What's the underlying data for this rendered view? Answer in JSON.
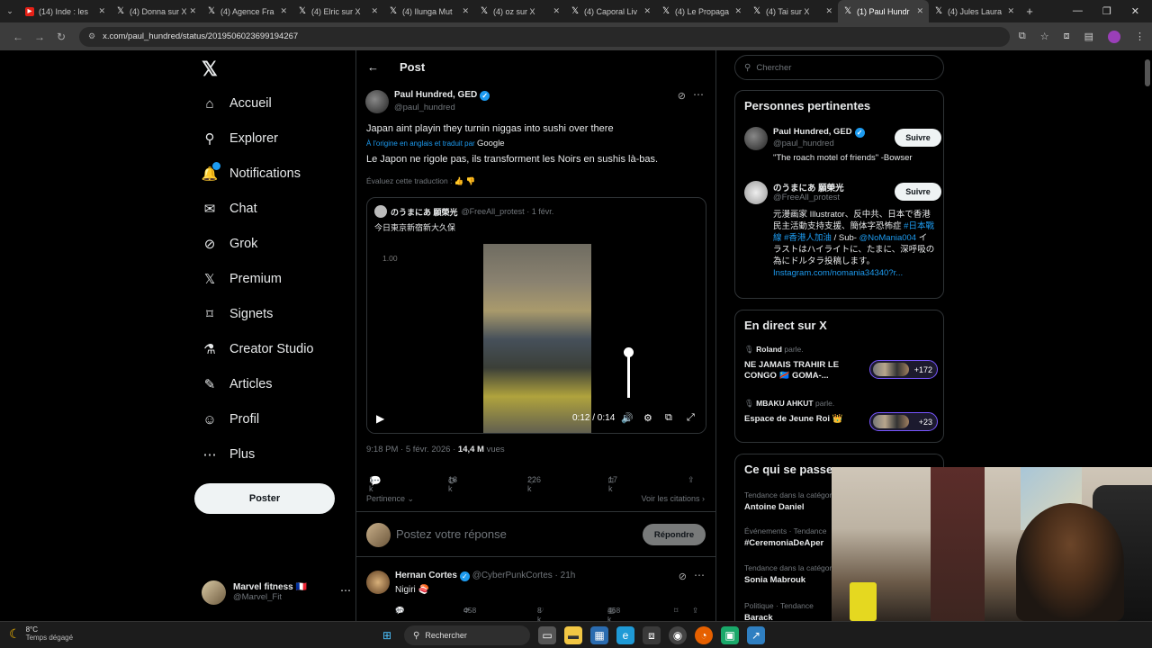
{
  "browser": {
    "tabs": [
      {
        "label": "(14) Inde : les",
        "icon": "youtube-icon",
        "active": false
      },
      {
        "label": "(4) Donna sur X",
        "icon": "x-icon",
        "active": false
      },
      {
        "label": "(4) Agence Fra",
        "icon": "x-icon",
        "active": false
      },
      {
        "label": "(4) Elric sur X",
        "icon": "x-icon",
        "active": false
      },
      {
        "label": "(4) Ilunga Mut",
        "icon": "x-icon",
        "active": false
      },
      {
        "label": "(4) oz sur X",
        "icon": "x-icon",
        "active": false
      },
      {
        "label": "(4) Caporal Liv",
        "icon": "x-icon",
        "active": false
      },
      {
        "label": "(4) Le Propaga",
        "icon": "x-icon",
        "active": false
      },
      {
        "label": "(4) Tai sur X",
        "icon": "x-icon",
        "active": false
      },
      {
        "label": "(1) Paul Hundr",
        "icon": "x-icon",
        "active": true
      },
      {
        "label": "(4) Jules Laura",
        "icon": "x-icon",
        "active": false
      }
    ],
    "url": "x.com/paul_hundred/status/2019506023699194267"
  },
  "nav": {
    "items": [
      {
        "label": "Accueil",
        "icon": "home-icon",
        "glyph": "⌂"
      },
      {
        "label": "Explorer",
        "icon": "search-icon",
        "glyph": "⚲"
      },
      {
        "label": "Notifications",
        "icon": "bell-icon",
        "glyph": "🔔"
      },
      {
        "label": "Chat",
        "icon": "mail-icon",
        "glyph": "✉"
      },
      {
        "label": "Grok",
        "icon": "grok-icon",
        "glyph": "⊘"
      },
      {
        "label": "Premium",
        "icon": "x-premium-icon",
        "glyph": "𝕏"
      },
      {
        "label": "Signets",
        "icon": "bookmark-icon",
        "glyph": "⌑"
      },
      {
        "label": "Creator Studio",
        "icon": "flask-icon",
        "glyph": "⚗"
      },
      {
        "label": "Articles",
        "icon": "article-icon",
        "glyph": "✎"
      },
      {
        "label": "Profil",
        "icon": "person-icon",
        "glyph": "☺"
      },
      {
        "label": "Plus",
        "icon": "more-circle-icon",
        "glyph": "⋯"
      }
    ],
    "post_label": "Poster",
    "me": {
      "name": "Marvel fitness 🇫🇷",
      "handle": "@Marvel_Fit"
    }
  },
  "main": {
    "header_title": "Post",
    "author": {
      "name": "Paul Hundred, GED",
      "handle": "@paul_hundred"
    },
    "text": "Japan aint playin they turnin niggas into sushi over there",
    "translated_prefix": "À l'origine en anglais et traduit par",
    "translated_by": "Google",
    "text_fr": "Le Japon ne rigole pas, ils transforment les Noirs en sushis là-bas.",
    "rate_translation": "Évaluez cette traduction :",
    "quote": {
      "name": "のうまにあ 願榮光",
      "handle": "@FreeAll_protest",
      "date": "· 1 févr.",
      "text": "今日東京新宿新大久保",
      "video": {
        "rate": "1.00",
        "time": "0:12 / 0:14",
        "volume_level": 0.85
      }
    },
    "timestamp": "9:18 PM · 5 févr. 2026 ·",
    "views_count": "14,4 M",
    "views_label": "vues",
    "stats": {
      "replies": "1 k",
      "reposts": "18 k",
      "likes": "226 k",
      "bookmarks": "17 k"
    },
    "sort_label": "Pertinence",
    "quotes_label": "Voir les citations",
    "reply_placeholder": "Postez votre réponse",
    "reply_button": "Répondre",
    "reply": {
      "name": "Hernan Cortes",
      "handle": "@CyberPunkCortes",
      "time": "· 21h",
      "text": "Nigiri 🍣",
      "stats": {
        "replies": "96",
        "reposts": "458",
        "likes": "8 k",
        "views": "468 k"
      }
    }
  },
  "right": {
    "search_placeholder": "Chercher",
    "people_title": "Personnes pertinentes",
    "people": [
      {
        "name": "Paul Hundred, GED",
        "handle": "@paul_hundred",
        "follow": "Suivre",
        "bio": "\"The roach motel of friends\" -Bowser"
      },
      {
        "name": "のうまにあ 願榮光",
        "handle": "@FreeAll_protest",
        "follow": "Suivre",
        "bio_text": "元漫画家 Illustrator、反中共、日本で香港民主活動支持支援、簡体字恐怖症",
        "bio_tags": "#日本戰線 #香港人加油",
        "bio_sub": "/ Sub-",
        "bio_mention": "@NoMania004",
        "bio_rest": "イラストはハイライトに、たまに、深呼吸の為にドルタラ投稿します。",
        "bio_link": "Instagram.com/nomania34340?r..."
      }
    ],
    "live_title": "En direct sur X",
    "live": [
      {
        "host": "Roland",
        "suffix": "parle.",
        "title": "NE JAMAIS TRAHIR LE CONGO 🇨🇩 GOMA-...",
        "count": "+172"
      },
      {
        "host": "MBAKU AHKUT",
        "suffix": "parle.",
        "title": "Espace de Jeune Roi 👑",
        "count": "+23"
      }
    ],
    "trends_title": "Ce qui se passe",
    "trends": [
      {
        "context": "Tendance dans la catégorie",
        "name": "Antoine Daniel"
      },
      {
        "context": "Événements · Tendance",
        "name": "#CeremoniaDeAper"
      },
      {
        "context": "Tendance dans la catégorie",
        "name": "Sonia Mabrouk"
      },
      {
        "context": "Politique · Tendance",
        "name": "Barack"
      }
    ]
  },
  "taskbar": {
    "temperature": "8°C",
    "condition": "Temps dégagé",
    "search_label": "Rechercher"
  },
  "colors": {
    "accent": "#1d9bf0",
    "background": "#000000",
    "border": "#2f3336",
    "muted": "#71767b"
  }
}
